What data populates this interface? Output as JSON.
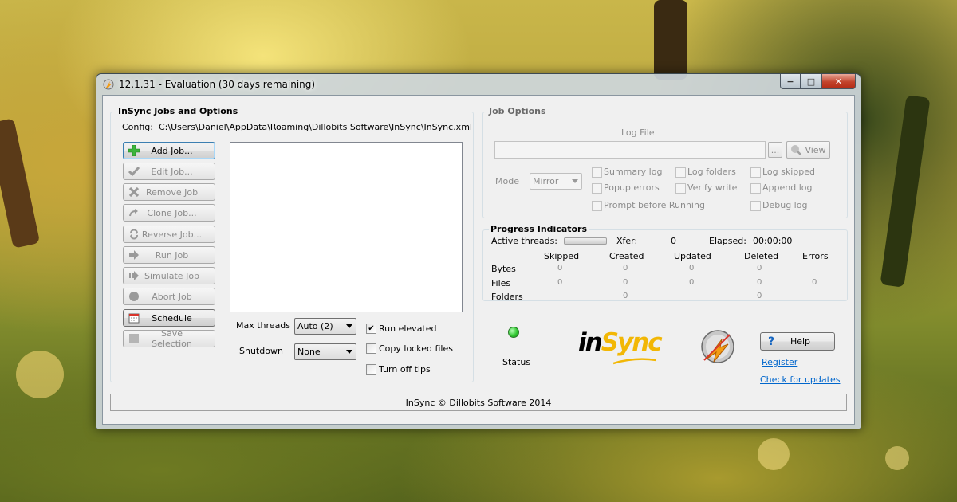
{
  "window": {
    "title": "12.1.31 - Evaluation (30 days remaining)",
    "controls": {
      "minimize": "−",
      "maximize": "□",
      "close": "✕"
    }
  },
  "left_panel": {
    "title": "InSync Jobs and Options",
    "config_label": "Config:",
    "config_path": "C:\\Users\\Daniel\\AppData\\Roaming\\Dillobits Software\\InSync\\InSync.xml",
    "buttons": [
      {
        "label": "Add Job...",
        "icon": "plus-icon",
        "enabled": true
      },
      {
        "label": "Edit Job...",
        "icon": "check-icon",
        "enabled": false
      },
      {
        "label": "Remove Job",
        "icon": "x-icon",
        "enabled": false
      },
      {
        "label": "Clone Job...",
        "icon": "curve-arrow-icon",
        "enabled": false
      },
      {
        "label": "Reverse Job...",
        "icon": "refresh-icon",
        "enabled": false
      },
      {
        "label": "Run Job",
        "icon": "arrow-right-icon",
        "enabled": false
      },
      {
        "label": "Simulate Job",
        "icon": "arrow-dashed-icon",
        "enabled": false
      },
      {
        "label": "Abort Job",
        "icon": "stop-icon",
        "enabled": false
      },
      {
        "label": "Schedule",
        "icon": "calendar-icon",
        "enabled": true
      },
      {
        "label": "Save Selection",
        "icon": "square-icon",
        "enabled": false
      }
    ],
    "max_threads_label": "Max threads",
    "max_threads_value": "Auto (2)",
    "shutdown_label": "Shutdown",
    "shutdown_value": "None",
    "run_elevated": {
      "label": "Run elevated",
      "checked": true
    },
    "copy_locked": {
      "label": "Copy locked files",
      "checked": false
    },
    "turn_off_tips": {
      "label": "Turn off tips",
      "checked": false
    }
  },
  "job_options": {
    "title": "Job Options",
    "log_file_label": "Log File",
    "browse_label": "...",
    "view_label": "View",
    "mode_label": "Mode",
    "mode_value": "Mirror",
    "checkboxes": {
      "summary_log": "Summary log",
      "log_folders": "Log folders",
      "log_skipped": "Log skipped",
      "popup_errors": "Popup errors",
      "verify_write": "Verify write",
      "append_log": "Append log",
      "prompt_before_running": "Prompt before Running",
      "debug_log": "Debug log"
    }
  },
  "progress": {
    "title": "Progress Indicators",
    "active_threads_label": "Active threads:",
    "xfer_label": "Xfer:",
    "xfer_value": "0",
    "elapsed_label": "Elapsed:",
    "elapsed_value": "00:00:00",
    "columns": [
      "Skipped",
      "Created",
      "Updated",
      "Deleted",
      "Errors"
    ],
    "rows": [
      {
        "label": "Bytes",
        "values": [
          "0",
          "0",
          "0",
          "0",
          ""
        ]
      },
      {
        "label": "Files",
        "values": [
          "0",
          "0",
          "0",
          "0",
          "0"
        ]
      },
      {
        "label": "Folders",
        "values": [
          "",
          "0",
          "",
          "0",
          ""
        ]
      }
    ]
  },
  "status": {
    "label": "Status",
    "indicator_color": "#32c832"
  },
  "brand": {
    "logo_text_in": "in",
    "logo_text_sync": "Sync",
    "accent_color": "#f2b705"
  },
  "help": {
    "help_label": "Help",
    "register_label": "Register",
    "updates_label": "Check for updates"
  },
  "footer": {
    "text": "InSync © Dillobits Software 2014"
  }
}
